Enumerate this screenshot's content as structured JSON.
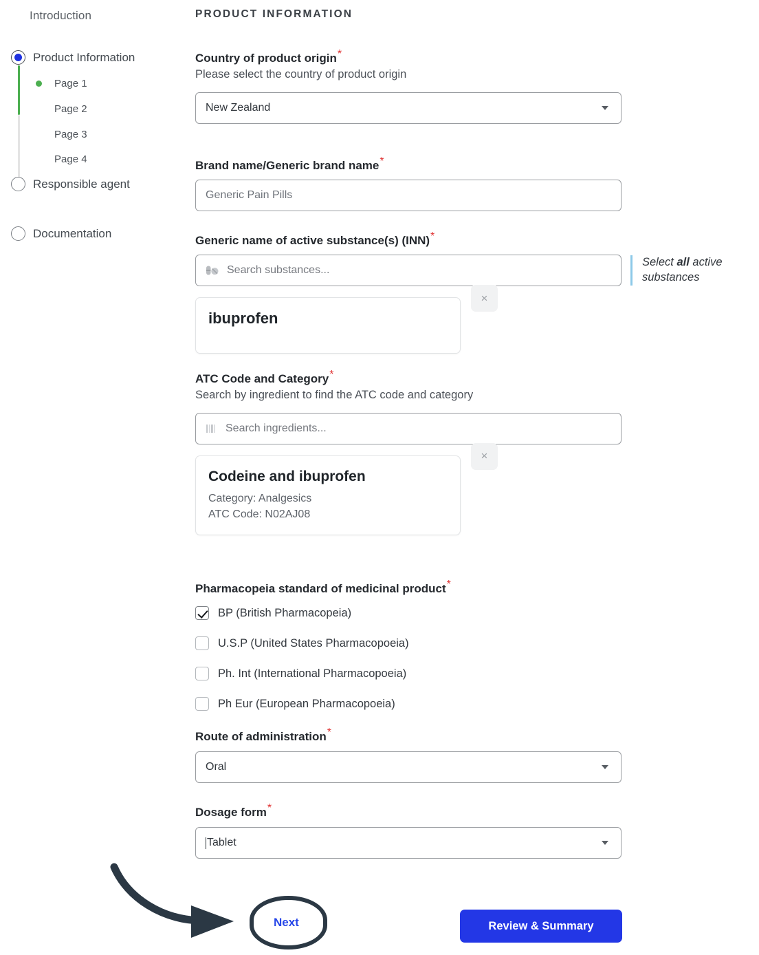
{
  "stepper": {
    "intro_label": "Introduction",
    "steps": [
      {
        "label": "Product Information",
        "state": "selected"
      },
      {
        "label": "Responsible agent",
        "state": "unselected"
      },
      {
        "label": "Documentation",
        "state": "unselected"
      }
    ],
    "pages": [
      {
        "label": "Page 1",
        "active": true
      },
      {
        "label": "Page 2",
        "active": false
      },
      {
        "label": "Page 3",
        "active": false
      },
      {
        "label": "Page 4",
        "active": false
      }
    ],
    "rail_active_color": "#4caf50",
    "rail_inactive_color": "#e4e4e4",
    "radio_fill_color": "#1f32e0"
  },
  "main": {
    "section_title": "PRODUCT INFORMATION",
    "required_marker": "*",
    "country": {
      "label": "Country of product origin",
      "hint": "Please select the country of product origin",
      "value": "New Zealand"
    },
    "brand": {
      "label": "Brand name/Generic brand name",
      "value": "Generic Pain Pills"
    },
    "substance": {
      "label": "Generic name of active substance(s) (INN)",
      "placeholder": "Search substances...",
      "icon": "pill-icon",
      "selected": {
        "name": "ibuprofen"
      },
      "remove_label": "×",
      "callout_before": "Select ",
      "callout_bold": "all",
      "callout_after": " active substances"
    },
    "atc": {
      "label": "ATC Code and Category",
      "hint": "Search by ingredient to find the ATC code and category",
      "placeholder": "Search ingredients...",
      "icon": "bars-icon",
      "selected": {
        "name": "Codeine and ibuprofen",
        "category": "Category: Analgesics",
        "code": "ATC Code: N02AJ08"
      },
      "remove_label": "×"
    },
    "pharmacopeia": {
      "label": "Pharmacopeia standard of medicinal product",
      "options": [
        {
          "label": "BP (British Pharmacopeia)",
          "checked": true
        },
        {
          "label": "U.S.P (United States Pharmacopoeia)",
          "checked": false
        },
        {
          "label": "Ph. Int (International Pharmacopoeia)",
          "checked": false
        },
        {
          "label": "Ph Eur (European Pharmacopoeia)",
          "checked": false
        }
      ]
    },
    "route": {
      "label": "Route of administration",
      "value": "Oral"
    },
    "dosage": {
      "label": "Dosage form",
      "value": "Tablet"
    }
  },
  "footer": {
    "next_label": "Next",
    "next_color": "#2747e8",
    "review_label": "Review & Summary",
    "review_bg_color": "#2337e6",
    "annotation_color": "#2b3844"
  }
}
